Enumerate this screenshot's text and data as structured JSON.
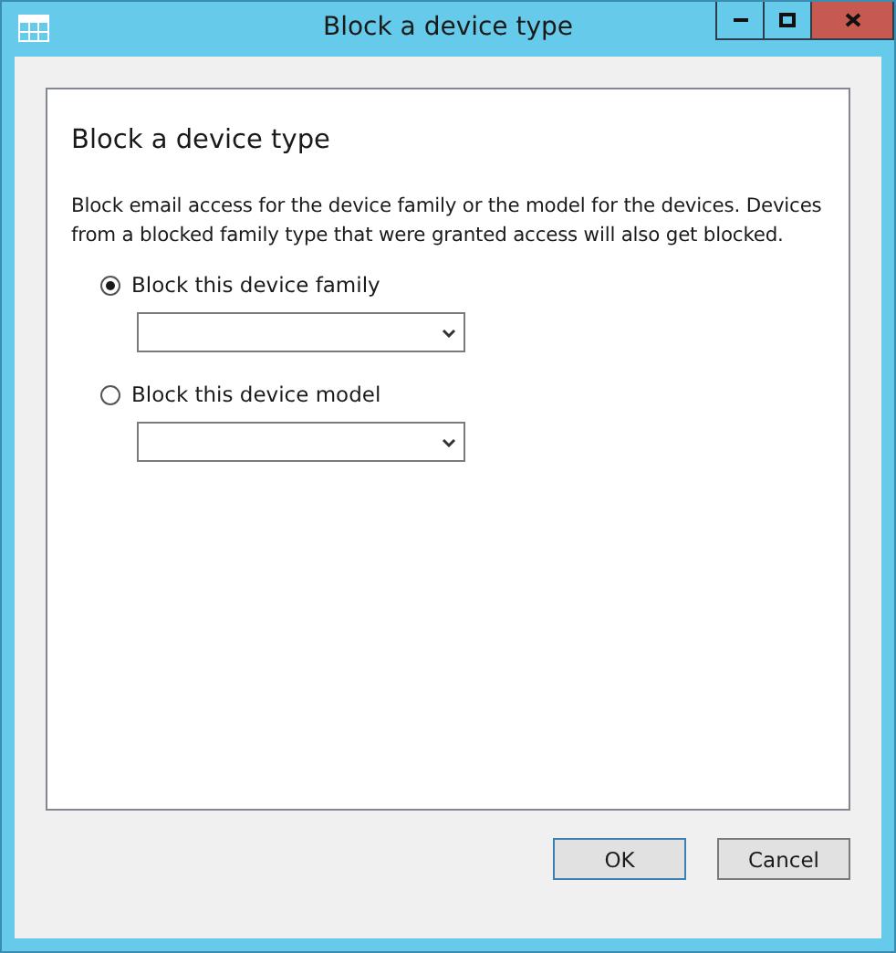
{
  "window": {
    "title": "Block a device type"
  },
  "panel": {
    "heading": "Block a device type",
    "description": "Block email access for the device family or the model for the devices. Devices from a blocked family type that were granted access will also get blocked."
  },
  "options": [
    {
      "label": "Block this device family",
      "selected": true
    },
    {
      "label": "Block this device model",
      "selected": false
    }
  ],
  "buttons": [
    {
      "label": "OK",
      "kind": "default"
    },
    {
      "label": "Cancel",
      "kind": "normal"
    }
  ]
}
